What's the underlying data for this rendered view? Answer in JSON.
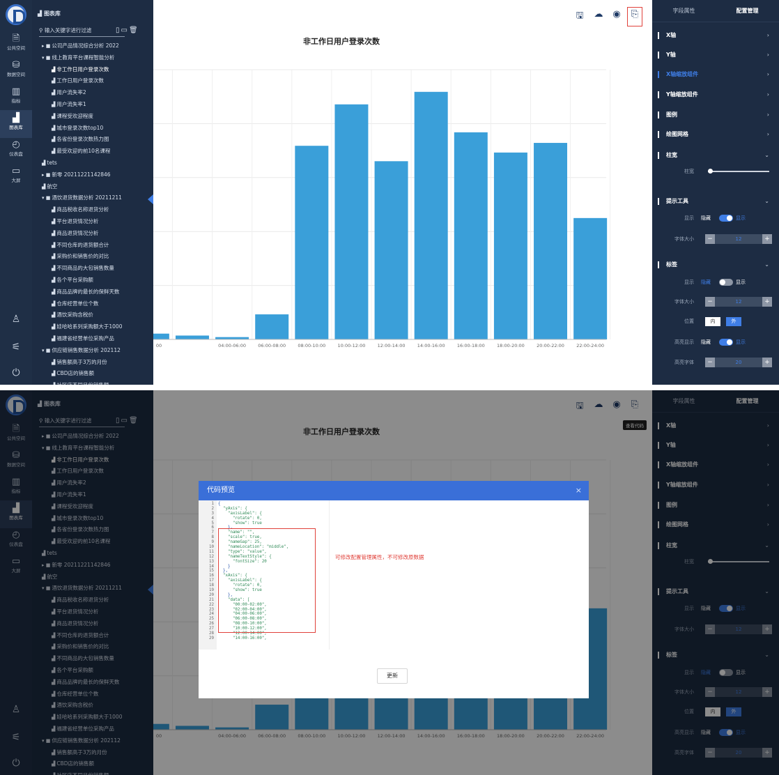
{
  "rail": [
    {
      "label": "公共空间",
      "icon": "document-icon",
      "glyph": "🗎"
    },
    {
      "label": "数据空间",
      "icon": "database-icon",
      "glyph": "⛁"
    },
    {
      "label": "指标",
      "icon": "metrics-icon",
      "glyph": "▥"
    },
    {
      "label": "图表库",
      "icon": "chart-library-icon",
      "glyph": "▟"
    },
    {
      "label": "仪表盘",
      "icon": "gauge-icon",
      "glyph": "◴"
    },
    {
      "label": "大屏",
      "icon": "monitor-icon",
      "glyph": "▭"
    }
  ],
  "rail_bottom": {
    "user": "user-icon",
    "settings": "settings-icon",
    "power": "power-icon"
  },
  "tree": {
    "title": "图表库",
    "search_placeholder": "输入关键字进行过滤",
    "items": [
      {
        "text": "公司产品情况综合分析 2022",
        "kind": "folder",
        "level": 0,
        "expanded": false
      },
      {
        "text": "线上教育平台课程智能分析",
        "kind": "folder",
        "level": 0,
        "expanded": true
      },
      {
        "text": "非工作日用户登录次数",
        "kind": "chart",
        "level": 1
      },
      {
        "text": "工作日用户登录次数",
        "kind": "chart",
        "level": 1
      },
      {
        "text": "用户流失率2",
        "kind": "chart",
        "level": 1
      },
      {
        "text": "用户流失率1",
        "kind": "chart",
        "level": 1
      },
      {
        "text": "课程受欢迎程度",
        "kind": "chart",
        "level": 1
      },
      {
        "text": "城市登录次数top10",
        "kind": "chart",
        "level": 1
      },
      {
        "text": "各省份登录次数热力图",
        "kind": "chart",
        "level": 1
      },
      {
        "text": "最受欢迎的前10名课程",
        "kind": "chart",
        "level": 1
      },
      {
        "text": "tets",
        "kind": "chart",
        "level": 0
      },
      {
        "text": "新零 20211221142846",
        "kind": "folder",
        "level": 0,
        "expanded": false
      },
      {
        "text": "航空",
        "kind": "chart",
        "level": 0
      },
      {
        "text": "酒饮退货数据分析 20211211",
        "kind": "folder",
        "level": 0,
        "expanded": true
      },
      {
        "text": "商品税收名称退货分析",
        "kind": "chart",
        "level": 1
      },
      {
        "text": "平台退货情况分析",
        "kind": "chart",
        "level": 1
      },
      {
        "text": "商品退货情况分析",
        "kind": "chart",
        "level": 1
      },
      {
        "text": "不同仓库的退货额合计",
        "kind": "chart",
        "level": 1
      },
      {
        "text": "采购价和销售价的对比",
        "kind": "chart",
        "level": 1
      },
      {
        "text": "不同商品的大包销售数量",
        "kind": "chart",
        "level": 1
      },
      {
        "text": "各个平台采购额",
        "kind": "chart",
        "level": 1
      },
      {
        "text": "商品品牌的最长的保鲜天数",
        "kind": "chart",
        "level": 1
      },
      {
        "text": "仓库经营单位个数",
        "kind": "chart",
        "level": 1
      },
      {
        "text": "酒饮采购含税价",
        "kind": "chart",
        "level": 1
      },
      {
        "text": "娃哈哈系列采购额大于1000",
        "kind": "chart",
        "level": 1
      },
      {
        "text": "福建省经营单位采购产品",
        "kind": "chart",
        "level": 1
      },
      {
        "text": "供应链销售数据分析 202112",
        "kind": "folder",
        "level": 0,
        "expanded": true
      },
      {
        "text": "销售额高于3万的月份",
        "kind": "chart",
        "level": 1
      },
      {
        "text": "CBD店的销售额",
        "kind": "chart",
        "level": 1
      },
      {
        "text": "社区店不同月份销售额",
        "kind": "chart",
        "level": 1
      }
    ]
  },
  "toolbar": {
    "save": "save-icon",
    "cloud": "cloud-upload-icon",
    "preview": "eye-icon",
    "code": "code-view-icon",
    "code_tooltip": "查看代码"
  },
  "panel": {
    "tabs": [
      "字段属性",
      "配置管理"
    ],
    "sections": [
      "X轴",
      "Y轴",
      "X轴缩放组件",
      "Y轴缩放组件",
      "图例",
      "绘图网格",
      "柱宽",
      "提示工具",
      "标签"
    ],
    "bar_width_label": "柱宽",
    "bar_width_level": 0.0,
    "tooltip_rows": {
      "show_label": "显示",
      "hide": "隐藏",
      "show": "显示",
      "font_label": "字体大小",
      "font_value": "12"
    },
    "label_rows": {
      "show_label": "显示",
      "hide": "隐藏",
      "show": "显示",
      "font_label": "字体大小",
      "font_value": "12",
      "position_label": "位置",
      "pos_in": "内",
      "pos_out": "外",
      "highlight_label": "高亮显示",
      "highlight_font_label": "高亮字体",
      "highlight_font_value": "20"
    }
  },
  "chart_data": {
    "type": "bar",
    "title": "非工作日用户登录次数",
    "categories": [
      "00:00-02:00",
      "02:00-04:00",
      "04:00-06:00",
      "06:00-08:00",
      "08:00-10:00",
      "10:00-12:00",
      "12:00-14:00",
      "14:00-16:00",
      "16:00-18:00",
      "18:00-20:00",
      "20:00-22:00",
      "22:00-24:00"
    ],
    "tick_labels": [
      "00",
      "04:00-06:00",
      "06:00-08:00",
      "08:00-10:00",
      "10:00-12:00",
      "12:00-14:00",
      "14:00-16:00",
      "16:00-18:00",
      "18:00-20:00",
      "20:00-22:00",
      "22:00-24:00"
    ],
    "values": [
      30,
      20,
      12,
      130,
      1005,
      1220,
      925,
      1285,
      1075,
      970,
      1020,
      630
    ],
    "ylim": [
      0,
      1400
    ],
    "grid": true,
    "color": "#3a9fd9"
  },
  "modal": {
    "title": "代码预览",
    "close": "×",
    "annotation": "可修改配置管理属性，不可修改原数据",
    "update_label": "更新",
    "code": [
      [
        "1",
        "{"
      ],
      [
        "2",
        "  \"yAxis\": {"
      ],
      [
        "3",
        "    \"axisLabel\": {"
      ],
      [
        "4",
        "      \"rotate\": 0,"
      ],
      [
        "5",
        "      \"show\": true"
      ],
      [
        "6",
        "    },"
      ],
      [
        "7",
        "    \"name\": \"\","
      ],
      [
        "8",
        "    \"scale\": true,"
      ],
      [
        "9",
        "    \"nameGap\": 25,"
      ],
      [
        "10",
        "    \"nameLocation\": \"middle\","
      ],
      [
        "11",
        "    \"type\": \"value\","
      ],
      [
        "12",
        "    \"nameTextStyle\": {"
      ],
      [
        "13",
        "      \"fontSize\": 20"
      ],
      [
        "14",
        "    }"
      ],
      [
        "15",
        "  },"
      ],
      [
        "16",
        "  \"xAxis\": {"
      ],
      [
        "17",
        "    \"axisLabel\": {"
      ],
      [
        "18",
        "      \"rotate\": 0,"
      ],
      [
        "19",
        "      \"show\": true"
      ],
      [
        "20",
        "    },"
      ],
      [
        "21",
        "    \"data\": ["
      ],
      [
        "22",
        "      \"00:00-02:00\","
      ],
      [
        "23",
        "      \"02:00-04:00\","
      ],
      [
        "24",
        "      \"04:00-06:00\","
      ],
      [
        "25",
        "      \"06:00-08:00\","
      ],
      [
        "26",
        "      \"08:00-10:00\","
      ],
      [
        "27",
        "      \"10:00-12:00\","
      ],
      [
        "28",
        "      \"12:00-14:00\","
      ],
      [
        "29",
        "      \"14:00-16:00\","
      ]
    ]
  }
}
